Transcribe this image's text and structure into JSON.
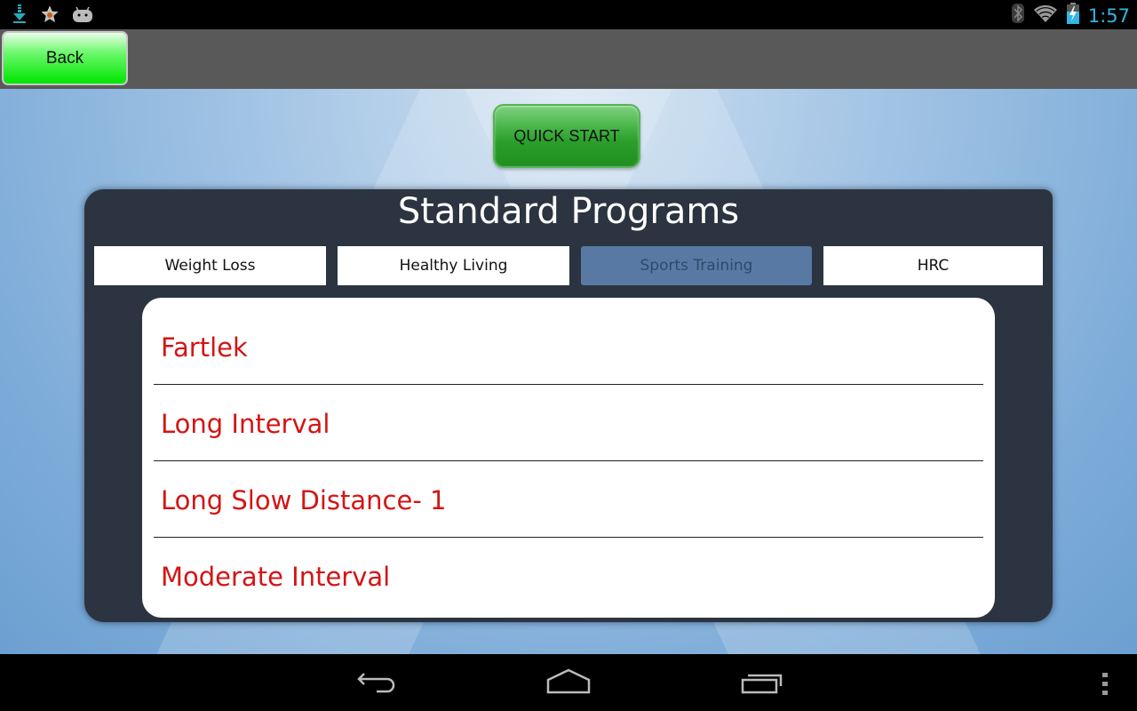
{
  "status_bar": {
    "left_icons": [
      "download-icon",
      "star-icon",
      "android-icon"
    ],
    "right_icons": [
      "bluetooth-icon",
      "wifi-icon",
      "battery-charging-icon"
    ],
    "time": "1:57"
  },
  "action_bar": {
    "back_label": "Back"
  },
  "main": {
    "quick_start_label": "QUICK START",
    "panel_title": "Standard Programs",
    "tabs": [
      {
        "label": "Weight Loss",
        "active": false
      },
      {
        "label": "Healthy Living",
        "active": false
      },
      {
        "label": "Sports Training",
        "active": true
      },
      {
        "label": "HRC",
        "active": false
      }
    ],
    "programs": [
      {
        "label": "Fartlek"
      },
      {
        "label": "Long Interval"
      },
      {
        "label": "Long Slow Distance- 1"
      },
      {
        "label": "Moderate Interval"
      }
    ]
  },
  "nav_bar": {
    "buttons": [
      "back-icon",
      "home-icon",
      "recent-apps-icon",
      "overflow-menu-icon"
    ]
  },
  "colors": {
    "accent_blue": "#33b5e5",
    "program_red": "#d41414",
    "panel_dark": "#2b3440",
    "active_tab": "#5879a3",
    "back_button_green": "#00e600",
    "quick_start_green": "#2a9e2a"
  }
}
